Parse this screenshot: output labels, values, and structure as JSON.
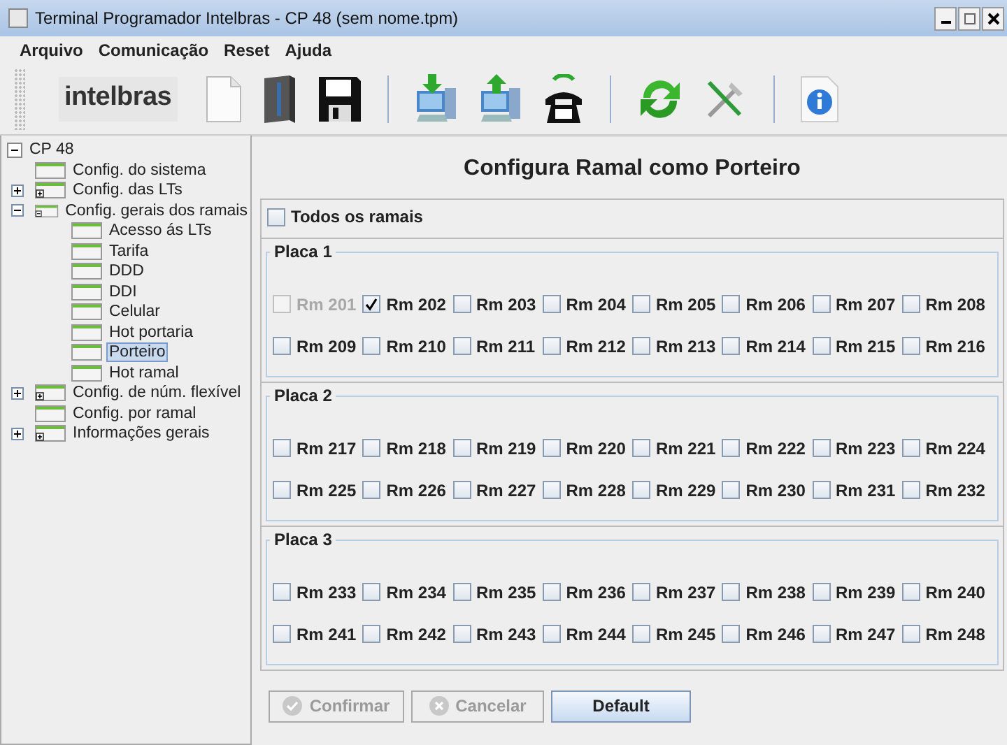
{
  "window": {
    "title": "Terminal Programador Intelbras - CP 48 (sem nome.tpm)"
  },
  "menu": [
    {
      "label": "Arquivo"
    },
    {
      "label": "Comunicação"
    },
    {
      "label": "Reset"
    },
    {
      "label": "Ajuda"
    }
  ],
  "toolbar": {
    "logo": "intelbras"
  },
  "tree": {
    "label": "CP 48",
    "expanded": true,
    "selected": false,
    "children": [
      {
        "label": "Config. do sistema",
        "selected": false
      },
      {
        "label": "Config. das LTs",
        "expanded": false,
        "selected": false
      },
      {
        "label": "Config. gerais dos ramais",
        "expanded": true,
        "selected": false,
        "children": [
          {
            "label": "Acesso ás LTs",
            "selected": false
          },
          {
            "label": "Tarifa",
            "selected": false
          },
          {
            "label": "DDD",
            "selected": false
          },
          {
            "label": "DDI",
            "selected": false
          },
          {
            "label": "Celular",
            "selected": false
          },
          {
            "label": "Hot portaria",
            "selected": false
          },
          {
            "label": "Porteiro",
            "selected": true
          },
          {
            "label": "Hot ramal",
            "selected": false
          }
        ]
      },
      {
        "label": "Config. de núm. flexível",
        "expanded": false,
        "selected": false
      },
      {
        "label": "Config. por ramal",
        "selected": false
      },
      {
        "label": "Informações gerais",
        "expanded": false,
        "selected": false
      }
    ]
  },
  "panel": {
    "heading": "Configura Ramal como Porteiro",
    "all": {
      "label": "Todos os ramais",
      "checked": false
    },
    "boards": [
      {
        "name": "Placa 1",
        "extensions": [
          {
            "label": "Rm 201",
            "checked": false,
            "disabled": true
          },
          {
            "label": "Rm 202",
            "checked": true,
            "disabled": false
          },
          {
            "label": "Rm 203",
            "checked": false,
            "disabled": false
          },
          {
            "label": "Rm 204",
            "checked": false,
            "disabled": false
          },
          {
            "label": "Rm 205",
            "checked": false,
            "disabled": false
          },
          {
            "label": "Rm 206",
            "checked": false,
            "disabled": false
          },
          {
            "label": "Rm 207",
            "checked": false,
            "disabled": false
          },
          {
            "label": "Rm 208",
            "checked": false,
            "disabled": false
          },
          {
            "label": "Rm 209",
            "checked": false,
            "disabled": false
          },
          {
            "label": "Rm 210",
            "checked": false,
            "disabled": false
          },
          {
            "label": "Rm 211",
            "checked": false,
            "disabled": false
          },
          {
            "label": "Rm 212",
            "checked": false,
            "disabled": false
          },
          {
            "label": "Rm 213",
            "checked": false,
            "disabled": false
          },
          {
            "label": "Rm 214",
            "checked": false,
            "disabled": false
          },
          {
            "label": "Rm 215",
            "checked": false,
            "disabled": false
          },
          {
            "label": "Rm 216",
            "checked": false,
            "disabled": false
          }
        ]
      },
      {
        "name": "Placa 2",
        "extensions": [
          {
            "label": "Rm 217",
            "checked": false,
            "disabled": false
          },
          {
            "label": "Rm 218",
            "checked": false,
            "disabled": false
          },
          {
            "label": "Rm 219",
            "checked": false,
            "disabled": false
          },
          {
            "label": "Rm 220",
            "checked": false,
            "disabled": false
          },
          {
            "label": "Rm 221",
            "checked": false,
            "disabled": false
          },
          {
            "label": "Rm 222",
            "checked": false,
            "disabled": false
          },
          {
            "label": "Rm 223",
            "checked": false,
            "disabled": false
          },
          {
            "label": "Rm 224",
            "checked": false,
            "disabled": false
          },
          {
            "label": "Rm 225",
            "checked": false,
            "disabled": false
          },
          {
            "label": "Rm 226",
            "checked": false,
            "disabled": false
          },
          {
            "label": "Rm 227",
            "checked": false,
            "disabled": false
          },
          {
            "label": "Rm 228",
            "checked": false,
            "disabled": false
          },
          {
            "label": "Rm 229",
            "checked": false,
            "disabled": false
          },
          {
            "label": "Rm 230",
            "checked": false,
            "disabled": false
          },
          {
            "label": "Rm 231",
            "checked": false,
            "disabled": false
          },
          {
            "label": "Rm 232",
            "checked": false,
            "disabled": false
          }
        ]
      },
      {
        "name": "Placa 3",
        "extensions": [
          {
            "label": "Rm 233",
            "checked": false,
            "disabled": false
          },
          {
            "label": "Rm 234",
            "checked": false,
            "disabled": false
          },
          {
            "label": "Rm 235",
            "checked": false,
            "disabled": false
          },
          {
            "label": "Rm 236",
            "checked": false,
            "disabled": false
          },
          {
            "label": "Rm 237",
            "checked": false,
            "disabled": false
          },
          {
            "label": "Rm 238",
            "checked": false,
            "disabled": false
          },
          {
            "label": "Rm 239",
            "checked": false,
            "disabled": false
          },
          {
            "label": "Rm 240",
            "checked": false,
            "disabled": false
          },
          {
            "label": "Rm 241",
            "checked": false,
            "disabled": false
          },
          {
            "label": "Rm 242",
            "checked": false,
            "disabled": false
          },
          {
            "label": "Rm 243",
            "checked": false,
            "disabled": false
          },
          {
            "label": "Rm 244",
            "checked": false,
            "disabled": false
          },
          {
            "label": "Rm 245",
            "checked": false,
            "disabled": false
          },
          {
            "label": "Rm 246",
            "checked": false,
            "disabled": false
          },
          {
            "label": "Rm 247",
            "checked": false,
            "disabled": false
          },
          {
            "label": "Rm 248",
            "checked": false,
            "disabled": false
          }
        ]
      }
    ],
    "buttons": [
      {
        "label": "Confirmar",
        "kind": "confirm",
        "disabled": true
      },
      {
        "label": "Cancelar",
        "kind": "cancel",
        "disabled": true
      },
      {
        "label": "Default",
        "kind": "plain",
        "disabled": false
      }
    ]
  }
}
